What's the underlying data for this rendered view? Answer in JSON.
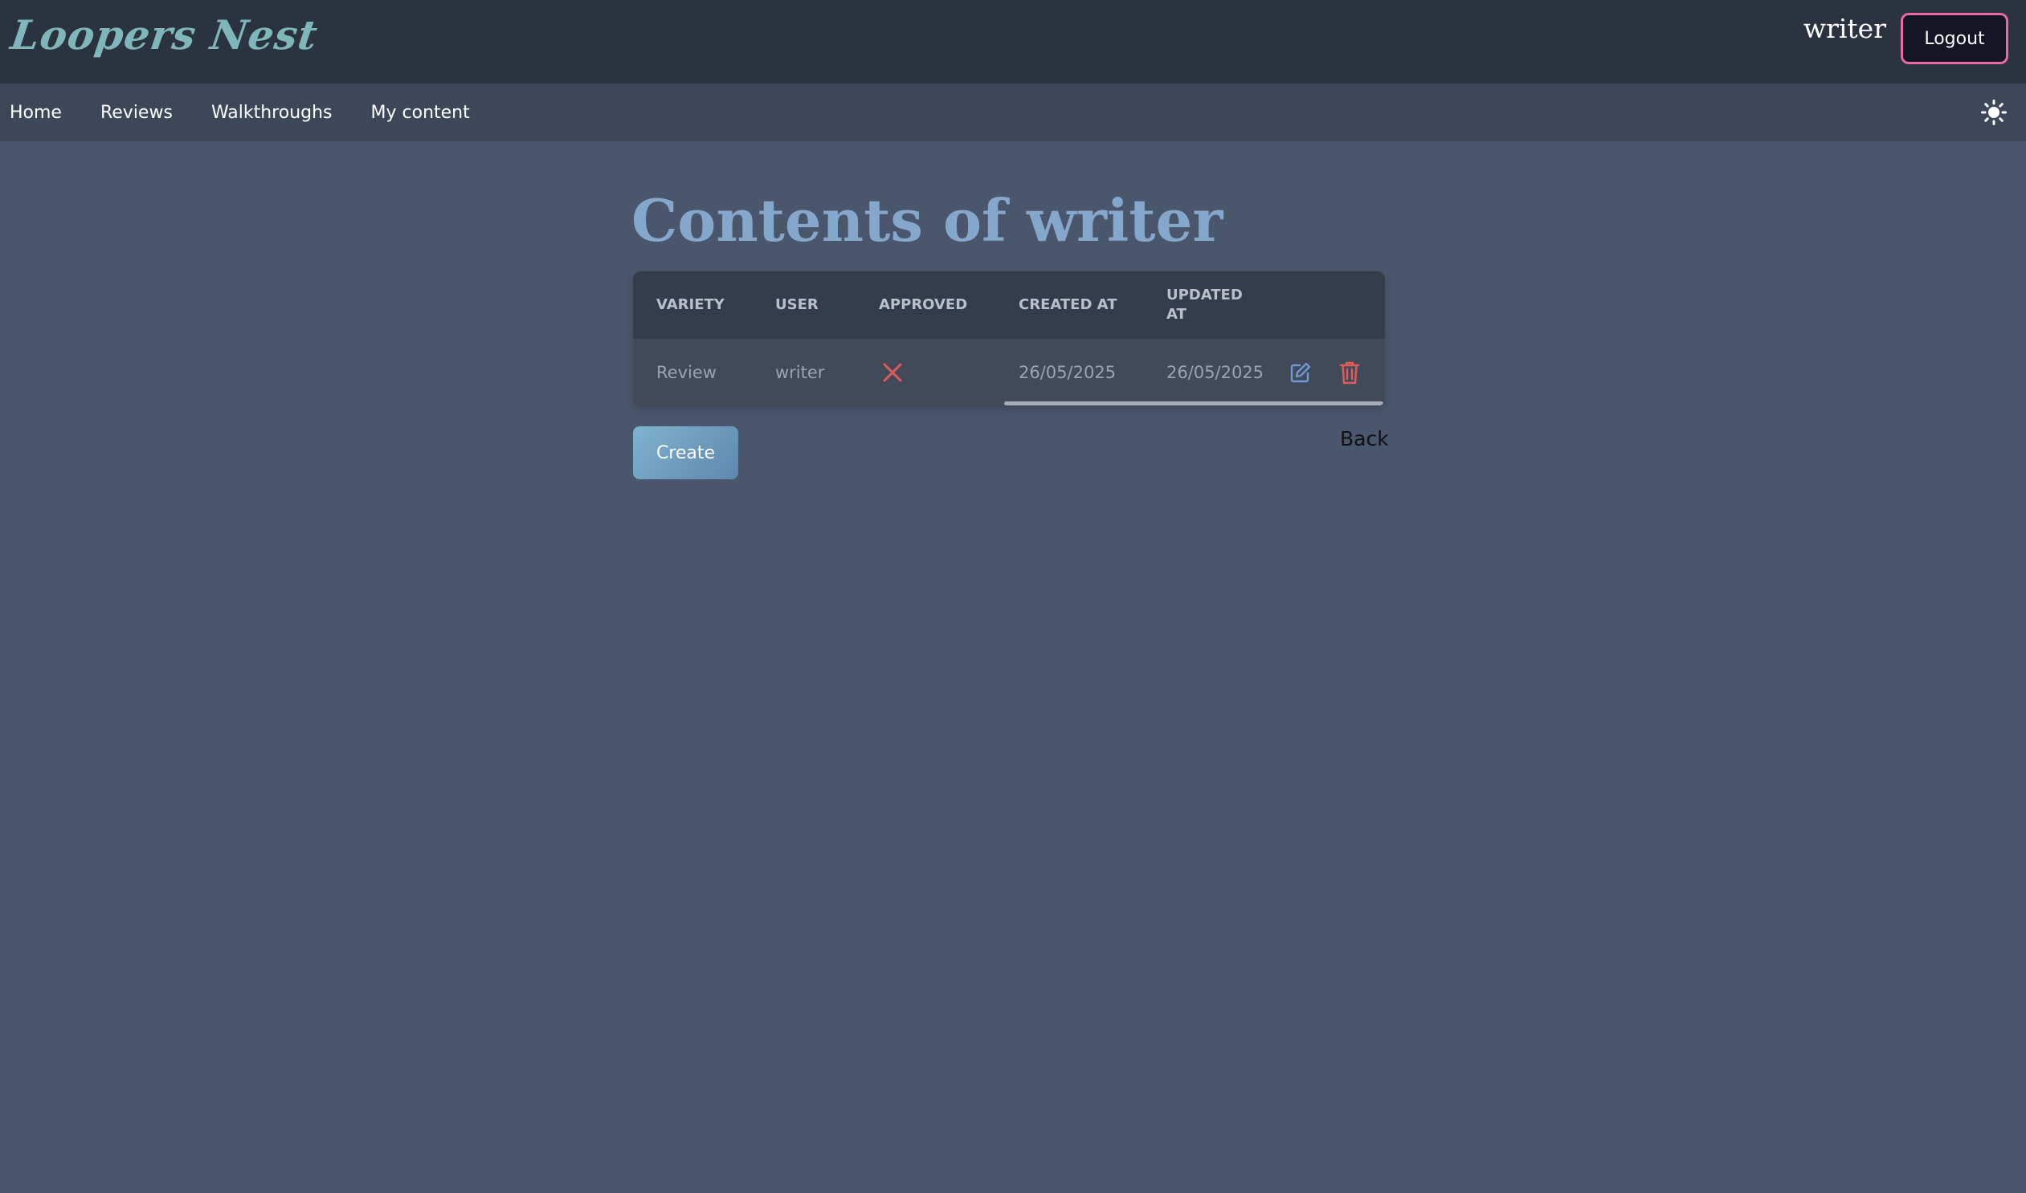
{
  "header": {
    "logo_text": "Loopers Nest",
    "username": "writer",
    "logout_label": "Logout"
  },
  "nav": {
    "items": [
      {
        "label": "Home"
      },
      {
        "label": "Reviews"
      },
      {
        "label": "Walkthroughs"
      },
      {
        "label": "My content"
      }
    ],
    "theme_toggle_icon": "sun-icon"
  },
  "main": {
    "title": "Contents of writer",
    "table": {
      "columns": [
        "VARIETY",
        "USER",
        "APPROVED",
        "CREATED AT",
        "UPDATED AT"
      ],
      "rows": [
        {
          "variety": "Review",
          "user": "writer",
          "approved_icon": "x-icon",
          "created_at": "26/05/2025",
          "updated_at": "26/05/2025",
          "edit_icon": "edit-icon",
          "delete_icon": "trash-icon"
        }
      ]
    },
    "create_label": "Create",
    "back_label": "Back"
  },
  "colors": {
    "header_bg": "#2c3340",
    "nav_bg": "#3e4759",
    "page_bg": "#4a566b",
    "logo": "#7fb6bb",
    "title": "#86a7cc",
    "logout_border": "#e76aa4",
    "reject": "#e05a5a",
    "edit": "#6e9ad0",
    "delete": "#e05a5a"
  }
}
